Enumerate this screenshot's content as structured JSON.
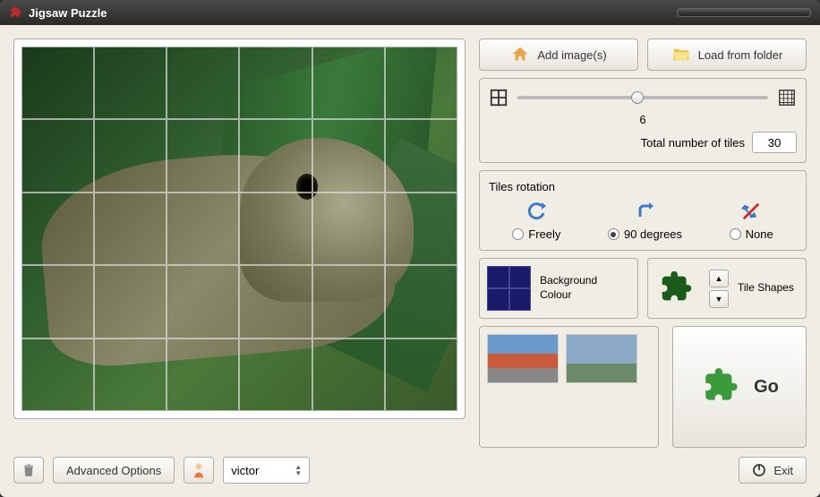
{
  "window": {
    "title": "Jigsaw Puzzle"
  },
  "buttons": {
    "add_images": "Add image(s)",
    "load_folder": "Load from folder",
    "advanced": "Advanced Options",
    "exit": "Exit",
    "go": "Go"
  },
  "slider": {
    "value": "6",
    "total_label": "Total number of tiles",
    "total_value": "30"
  },
  "rotation": {
    "title": "Tiles rotation",
    "options": {
      "freely": "Freely",
      "ninety": "90 degrees",
      "none": "None"
    },
    "selected": "ninety"
  },
  "style": {
    "bg_label": "Background Colour",
    "shape_label": "Tile Shapes"
  },
  "footer": {
    "user_select": "victor"
  }
}
